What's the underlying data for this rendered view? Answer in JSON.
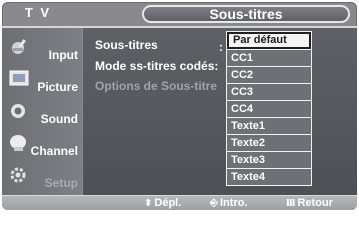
{
  "header": {
    "mode": "T V",
    "title": "Sous-titres"
  },
  "sidebar": {
    "items": [
      {
        "label": "Input",
        "icon": "input-icon"
      },
      {
        "label": "Picture",
        "icon": "picture-icon"
      },
      {
        "label": "Sound",
        "icon": "sound-icon"
      },
      {
        "label": "Channel",
        "icon": "channel-icon"
      },
      {
        "label": "Setup",
        "icon": "setup-icon"
      }
    ]
  },
  "menu": {
    "options": [
      {
        "label": "Sous-titres"
      },
      {
        "label": "Mode ss-titres codés:"
      },
      {
        "label": "Options de Sous-titre"
      }
    ],
    "colon": ":"
  },
  "dropdown": {
    "selected_index": 0,
    "items": [
      "Par défaut",
      "CC1",
      "CC2",
      "CC3",
      "CC4",
      "Texte1",
      "Texte2",
      "Texte3",
      "Texte4"
    ]
  },
  "footer": {
    "move_glyph": "⬍",
    "move": "Dépl.",
    "enter_glyph": "⎆",
    "enter": "Intro.",
    "return_glyph": "Ⅲ",
    "return": "Retour"
  },
  "colors": {
    "panel": "#55575d",
    "highlight": "#f4f4f4",
    "sidebar": "#76777c"
  }
}
